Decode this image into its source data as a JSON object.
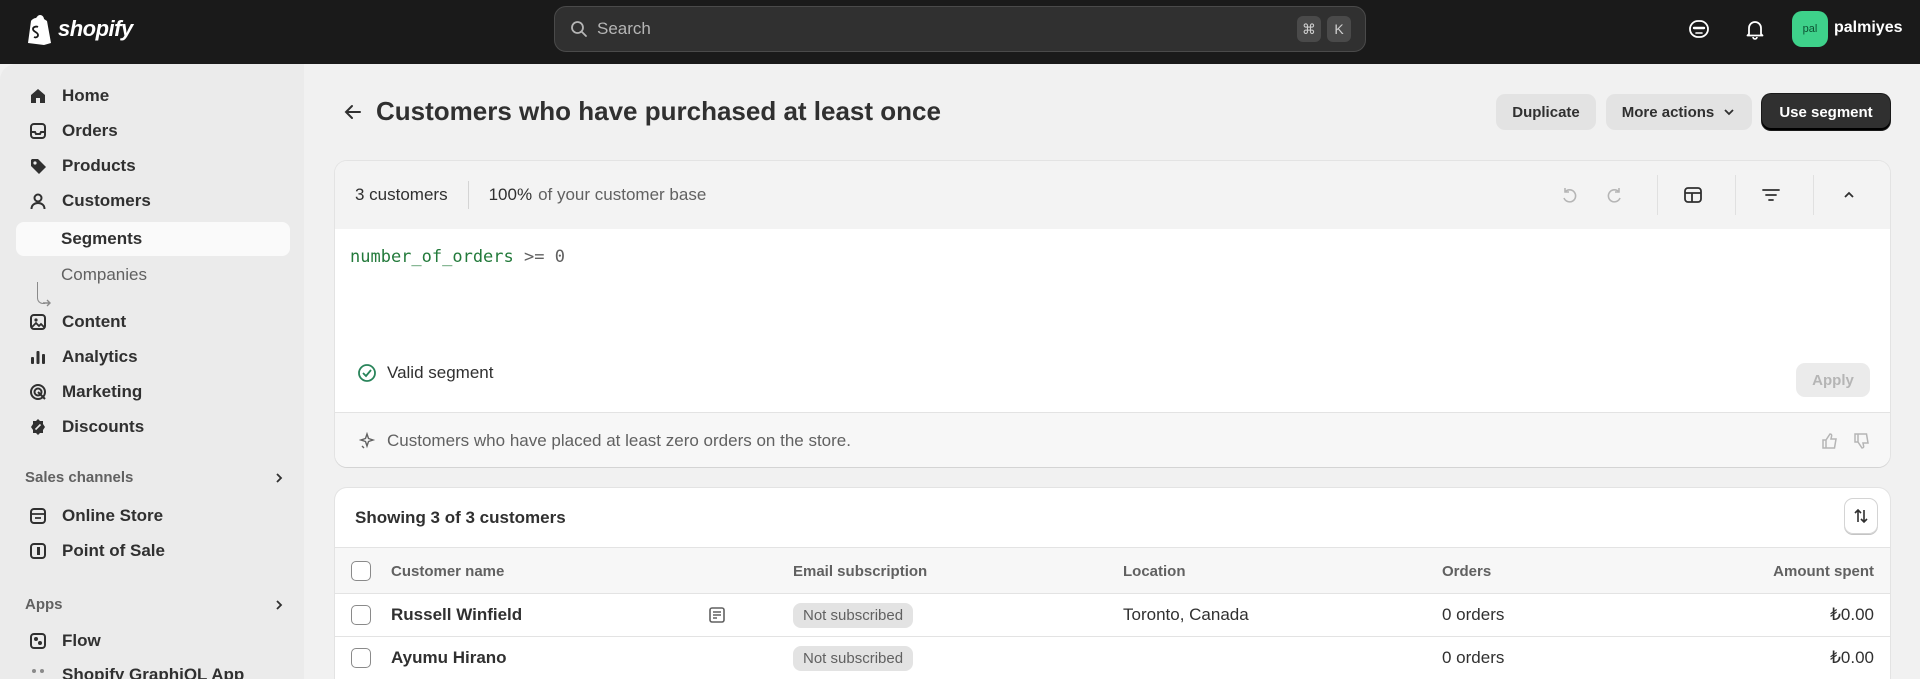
{
  "topbar": {
    "brand": "shopify",
    "search_placeholder": "Search",
    "shortcut_cmd": "⌘",
    "shortcut_key": "K",
    "avatar_initials": "pal",
    "store_name": "palmiyes"
  },
  "sidebar": {
    "items": [
      {
        "label": "Home"
      },
      {
        "label": "Orders"
      },
      {
        "label": "Products"
      },
      {
        "label": "Customers"
      },
      {
        "label": "Segments"
      },
      {
        "label": "Companies"
      },
      {
        "label": "Content"
      },
      {
        "label": "Analytics"
      },
      {
        "label": "Marketing"
      },
      {
        "label": "Discounts"
      }
    ],
    "sales_channels_label": "Sales channels",
    "sales_channels": [
      {
        "label": "Online Store"
      },
      {
        "label": "Point of Sale"
      }
    ],
    "apps_label": "Apps",
    "apps": [
      {
        "label": "Flow"
      },
      {
        "label": "Shopify GraphiQL App"
      }
    ]
  },
  "page": {
    "title": "Customers who have purchased at least once",
    "duplicate_label": "Duplicate",
    "more_actions_label": "More actions",
    "use_segment_label": "Use segment"
  },
  "segment": {
    "count_text": "3 customers",
    "base_pct": "100%",
    "base_text": "of your customer base",
    "query_field": "number_of_orders",
    "query_op": ">=",
    "query_value": "0",
    "valid_text": "Valid segment",
    "apply_label": "Apply",
    "ai_summary": "Customers who have placed at least zero orders on the store."
  },
  "table": {
    "showing_text": "Showing 3 of 3 customers",
    "columns": {
      "name": "Customer name",
      "email": "Email subscription",
      "location": "Location",
      "orders": "Orders",
      "amount": "Amount spent"
    },
    "rows": [
      {
        "name": "Russell Winfield",
        "email": "Not subscribed",
        "location": "Toronto, Canada",
        "orders": "0 orders",
        "amount": "₺0.00",
        "has_note": true
      },
      {
        "name": "Ayumu Hirano",
        "email": "Not subscribed",
        "location": "",
        "orders": "0 orders",
        "amount": "₺0.00",
        "has_note": false
      }
    ]
  }
}
